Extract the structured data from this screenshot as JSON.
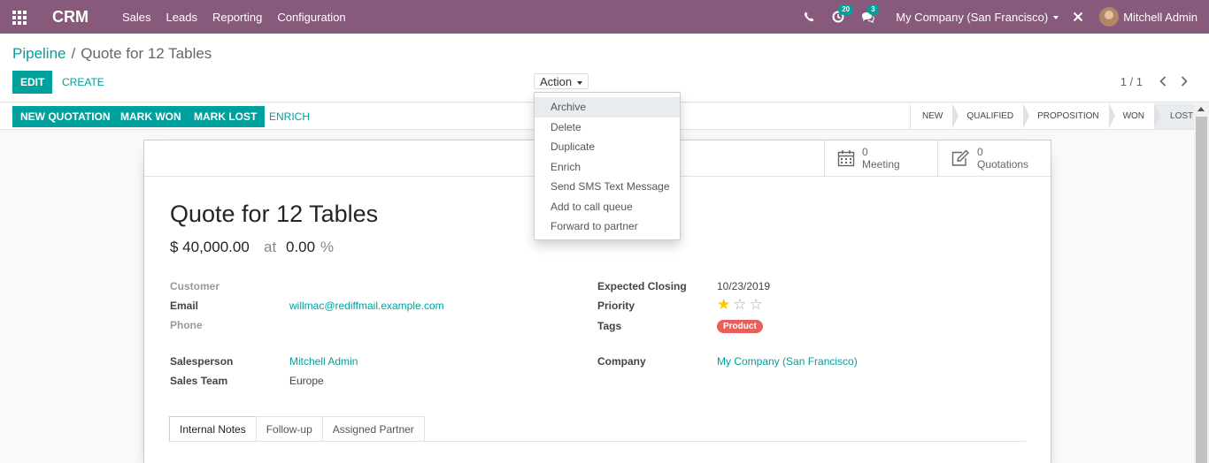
{
  "navbar": {
    "brand": "CRM",
    "menu": [
      "Sales",
      "Leads",
      "Reporting",
      "Configuration"
    ],
    "activity_count": "20",
    "message_count": "3",
    "company": "My Company (San Francisco)",
    "user": "Mitchell Admin",
    "accent_color": "#875a7b"
  },
  "breadcrumb": {
    "parent": "Pipeline",
    "separator": "/",
    "current": "Quote for 12 Tables"
  },
  "control": {
    "edit_label": "EDIT",
    "create_label": "CREATE",
    "action_label": "Action",
    "pager": "1 / 1"
  },
  "action_menu": {
    "items": [
      "Archive",
      "Delete",
      "Duplicate",
      "Enrich",
      "Send SMS Text Message",
      "Add to call queue",
      "Forward to partner"
    ]
  },
  "statusbar": {
    "buttons": [
      "NEW QUOTATION",
      "MARK WON",
      "MARK LOST"
    ],
    "enrich_label": "ENRICH",
    "stages": [
      "NEW",
      "QUALIFIED",
      "PROPOSITION",
      "WON",
      "LOST"
    ],
    "active_stage": "LOST"
  },
  "smart_buttons": {
    "meeting_count": "0",
    "meeting_label": "Meeting",
    "quotation_count": "0",
    "quotation_label": "Quotations"
  },
  "lead": {
    "title": "Quote for 12 Tables",
    "revenue": "$ 40,000.00",
    "at": "at",
    "probability": "0.00",
    "percent": "%",
    "customer_label": "Customer",
    "email_label": "Email",
    "email": "willmac@rediffmail.example.com",
    "phone_label": "Phone",
    "salesperson_label": "Salesperson",
    "salesperson": "Mitchell Admin",
    "sales_team_label": "Sales Team",
    "sales_team": "Europe",
    "expected_closing_label": "Expected Closing",
    "expected_closing": "10/23/2019",
    "priority_label": "Priority",
    "priority_stars": 1,
    "priority_max": 3,
    "tags_label": "Tags",
    "tag": "Product",
    "company_label": "Company",
    "company": "My Company (San Francisco)"
  },
  "tabs": [
    "Internal Notes",
    "Follow-up",
    "Assigned Partner"
  ],
  "active_tab": "Internal Notes"
}
